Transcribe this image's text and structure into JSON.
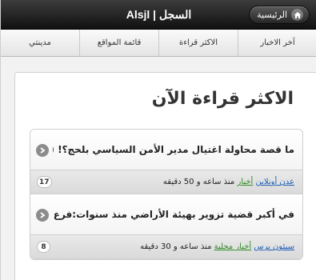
{
  "header": {
    "title": "Alsjl | السجل",
    "home_label": "الرئيسية"
  },
  "nav": {
    "items": [
      "آخر الاخبار",
      "الاكثر قراءة",
      "قائمة المواقع",
      "مدينتي"
    ]
  },
  "section": {
    "title": "الاكثر قراءة الآن"
  },
  "articles": [
    {
      "title": "ما قصة محاولة اغتيال مدير الأمن السياسي بلحج؟! (صور خا...",
      "source": "عدن أونلاين",
      "category": "أخبار",
      "time": "منذ ساعه و 50 دقيقه",
      "count": "17"
    },
    {
      "title": "في أكبر قضية تزوير بهيئة الأراضي منذ سنوات:فرع الجهاز ا...",
      "source": "سيئون برس",
      "category": "أخبار محلية",
      "time": "منذ ساعه و 30 دقيقه",
      "count": "8"
    }
  ],
  "colors": {
    "header_bg": "#1c1c1c",
    "link_blue": "#1a5fb4",
    "link_green": "#2e8b23"
  }
}
